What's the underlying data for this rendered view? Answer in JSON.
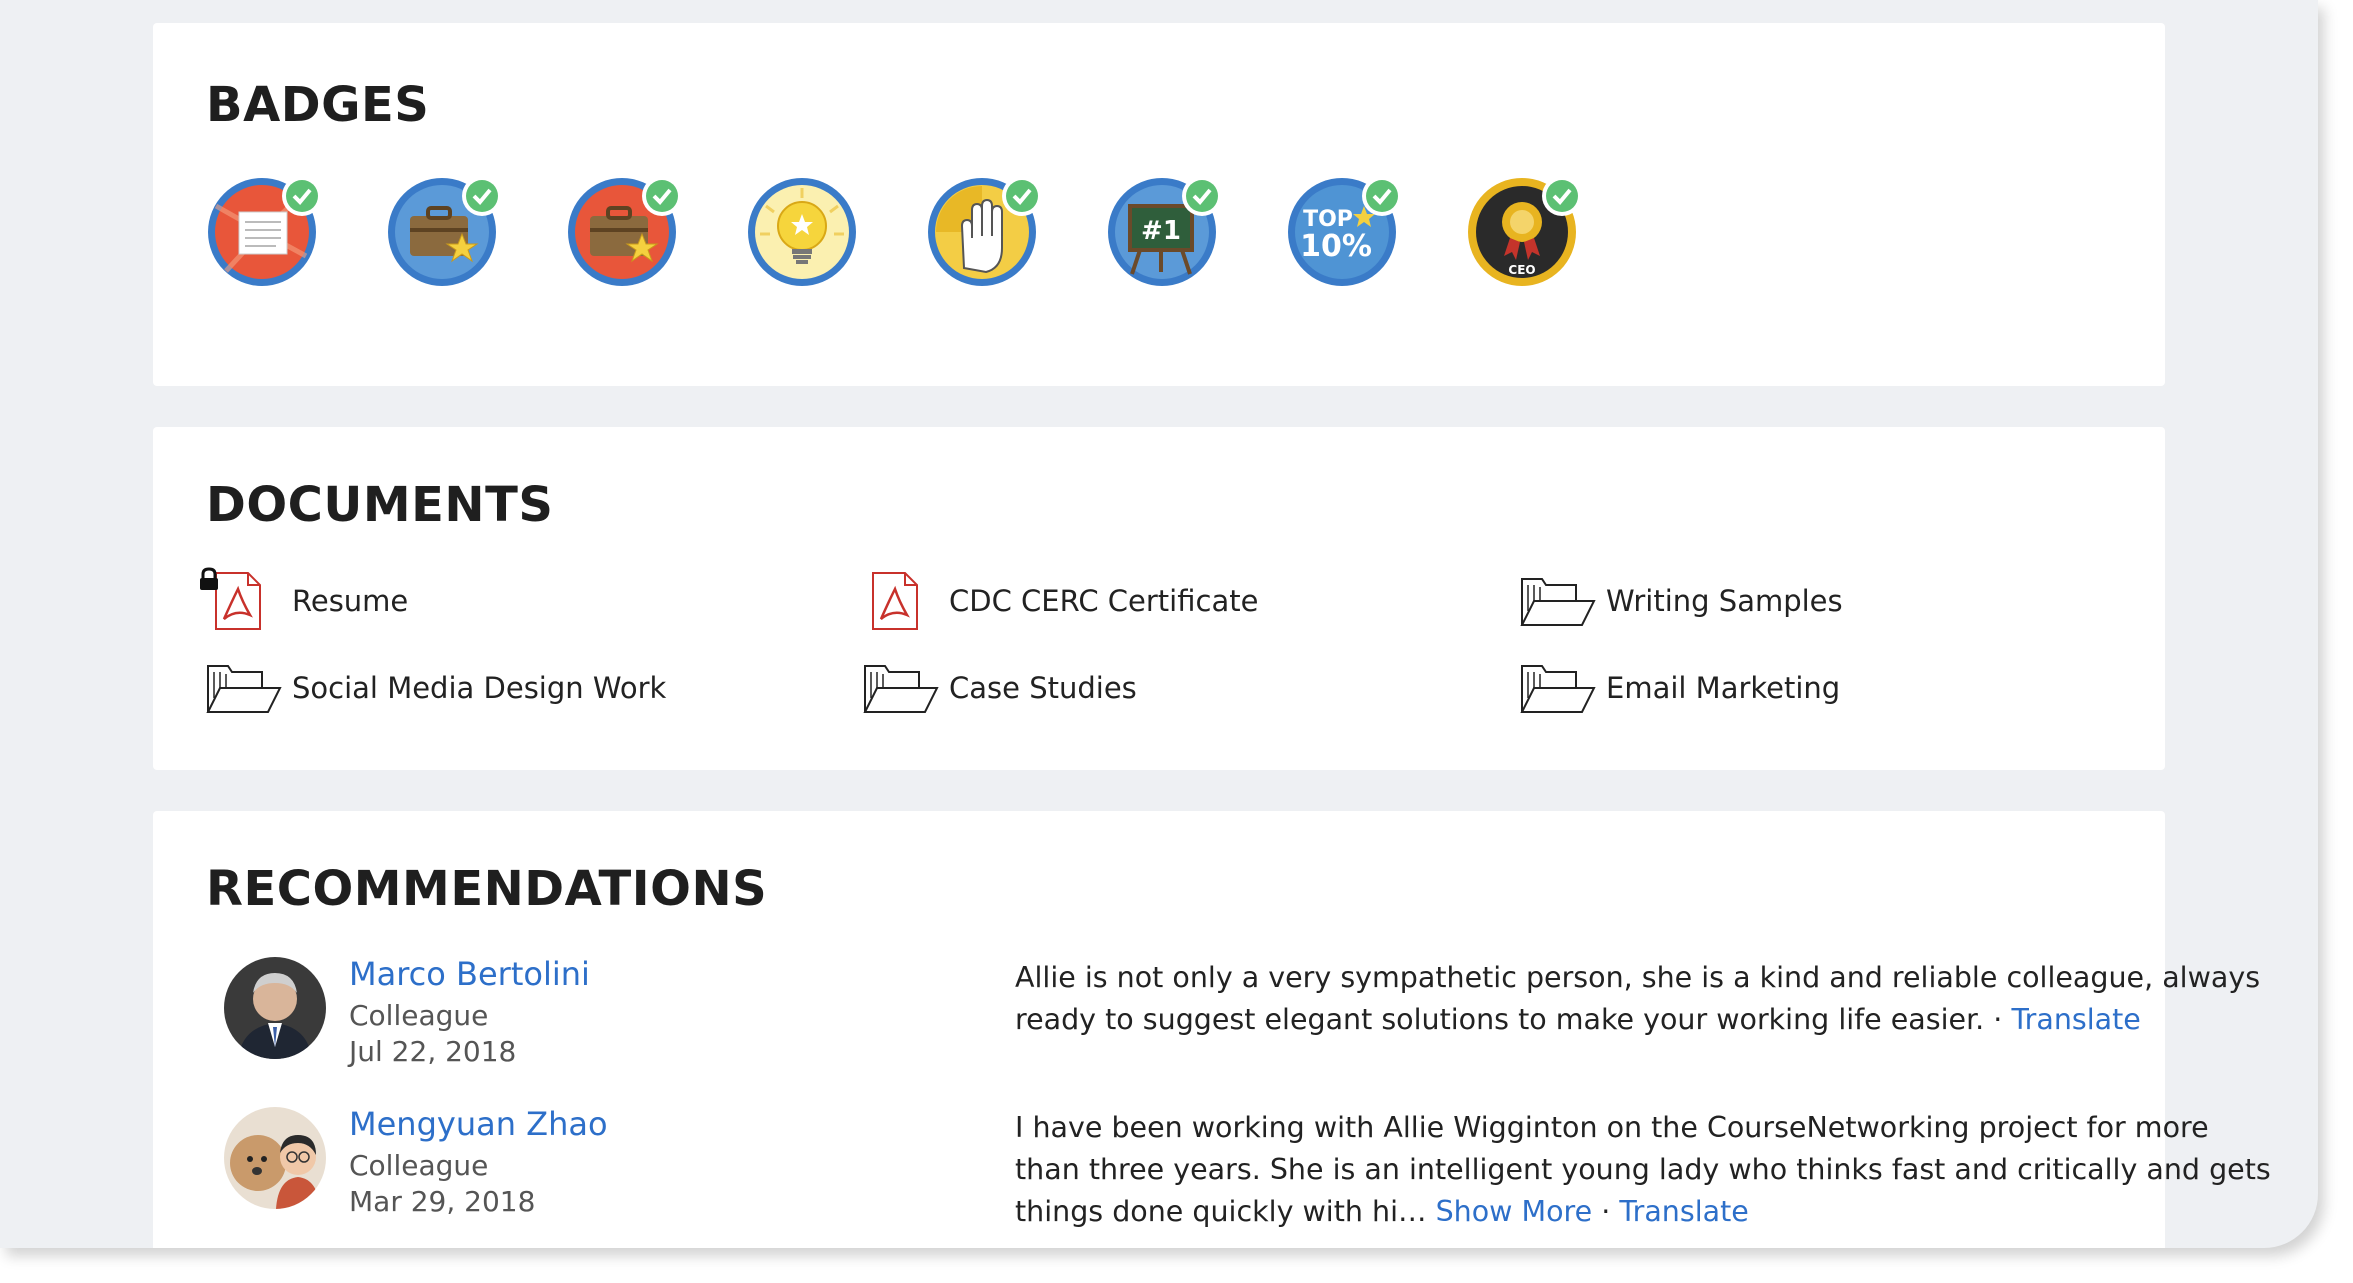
{
  "badges": {
    "title": "BADGES",
    "items": [
      {
        "name": "document-badge-icon",
        "ring": "#3a7bc8",
        "bg": "#e8563a",
        "earned": true
      },
      {
        "name": "briefcase-star-badge-icon",
        "ring": "#3a7bc8",
        "bg": "#4f94d4",
        "earned": true
      },
      {
        "name": "briefcase-star-red-badge-icon",
        "ring": "#3a7bc8",
        "bg": "#e8563a",
        "earned": true
      },
      {
        "name": "lightbulb-badge-icon",
        "ring": "#3a7bc8",
        "bg": "#f7e27a",
        "earned": false
      },
      {
        "name": "raised-hand-badge-icon",
        "ring": "#3a7bc8",
        "bg": "#f0c93a",
        "earned": true
      },
      {
        "name": "number-one-chalkboard-badge-icon",
        "ring": "#3a7bc8",
        "bg": "#3a7bc8",
        "earned": true
      },
      {
        "name": "top-10-percent-badge-icon",
        "ring": "#3a7bc8",
        "bg": "#4f94d4",
        "earned": true,
        "text1": "TOP",
        "text2": "10%"
      },
      {
        "name": "ceo-medal-badge-icon",
        "ring": "#e8b420",
        "bg": "#2a2a2a",
        "earned": true,
        "text1": "CEO"
      }
    ]
  },
  "documents": {
    "title": "DOCUMENTS",
    "items": [
      {
        "label": "Resume",
        "type": "pdf",
        "locked": true
      },
      {
        "label": "CDC CERC Certificate",
        "type": "pdf",
        "locked": false
      },
      {
        "label": "Writing Samples",
        "type": "folder",
        "locked": false
      },
      {
        "label": "Social Media Design Work",
        "type": "folder",
        "locked": false
      },
      {
        "label": "Case Studies",
        "type": "folder",
        "locked": false
      },
      {
        "label": "Email Marketing",
        "type": "folder",
        "locked": false
      }
    ]
  },
  "recommendations": {
    "title": "RECOMMENDATIONS",
    "items": [
      {
        "name": "Marco Bertolini",
        "role": "Colleague",
        "date": "Jul 22, 2018",
        "text": "Allie is not only a very sympathetic person, she is a kind and reliable colleague, always ready to suggest elegant solutions to make your working life easier.",
        "separator": " · ",
        "translate": "Translate"
      },
      {
        "name": "Mengyuan Zhao",
        "role": "Colleague",
        "date": "Mar 29, 2018",
        "text": "I have been working with Allie Wigginton on the CourseNetworking project for more than three years. She is an intelligent young lady who thinks fast and critically and gets things done quickly with hi…",
        "show_more": "Show More",
        "separator": " · ",
        "translate": "Translate"
      }
    ]
  },
  "colors": {
    "link": "#2d6fc9",
    "check": "#5cc073",
    "pdf_red": "#c8312b",
    "page_bg": "#eef0f3"
  }
}
